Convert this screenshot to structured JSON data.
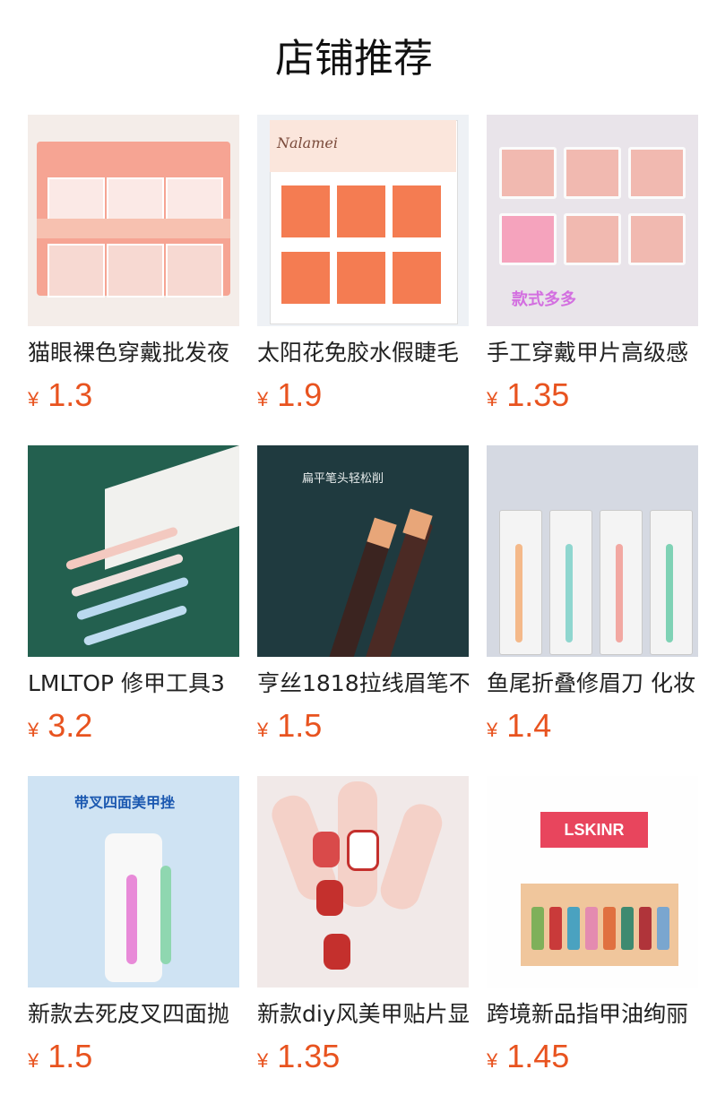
{
  "header": {
    "title": "店铺推荐"
  },
  "products": [
    {
      "name": "猫眼裸色穿戴批发夜",
      "currency": "¥",
      "price": "1.3",
      "thumb_text": ""
    },
    {
      "name": "太阳花免胶水假睫毛",
      "currency": "¥",
      "price": "1.9",
      "thumb_text": "Nalamei"
    },
    {
      "name": "手工穿戴甲片高级感",
      "currency": "¥",
      "price": "1.35",
      "thumb_text": "款式多多"
    },
    {
      "name": "LMLTOP 修甲工具3",
      "currency": "¥",
      "price": "3.2",
      "thumb_text": ""
    },
    {
      "name": "亨丝1818拉线眉笔不",
      "currency": "¥",
      "price": "1.5",
      "thumb_text": "扁平笔头轻松削"
    },
    {
      "name": "鱼尾折叠修眉刀 化妆",
      "currency": "¥",
      "price": "1.4",
      "thumb_text": ""
    },
    {
      "name": "新款去死皮叉四面抛",
      "currency": "¥",
      "price": "1.5",
      "thumb_text": "带叉四面美甲挫"
    },
    {
      "name": "新款diy风美甲贴片显",
      "currency": "¥",
      "price": "1.35",
      "thumb_text": ""
    },
    {
      "name": "跨境新品指甲油绚丽",
      "currency": "¥",
      "price": "1.45",
      "thumb_text": "LSKINR"
    }
  ],
  "colors": {
    "price": "#e8531f",
    "text": "#222222"
  }
}
